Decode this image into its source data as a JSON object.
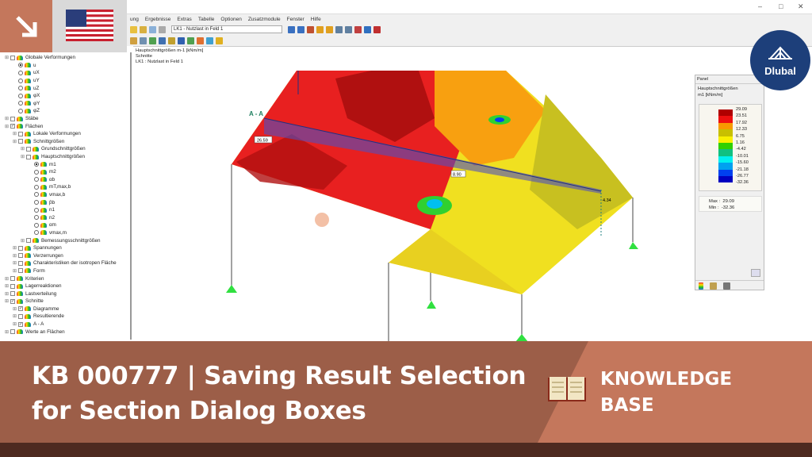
{
  "menu": [
    "ung",
    "Ergebnisse",
    "Extras",
    "Tabelle",
    "Optionen",
    "Zusatzmodule",
    "Fenster",
    "Hilfe"
  ],
  "toolbar": {
    "loadcase": "LK1 - Nutzlast in Feld 1"
  },
  "tree": [
    {
      "l": 0,
      "k": "box",
      "t": "Globale Verformungen"
    },
    {
      "l": 1,
      "k": "rad",
      "on": true,
      "t": "u"
    },
    {
      "l": 1,
      "k": "rad",
      "t": "uX"
    },
    {
      "l": 1,
      "k": "rad",
      "t": "uY"
    },
    {
      "l": 1,
      "k": "rad",
      "t": "uZ"
    },
    {
      "l": 1,
      "k": "rad",
      "t": "φX"
    },
    {
      "l": 1,
      "k": "rad",
      "t": "φY"
    },
    {
      "l": 1,
      "k": "rad",
      "t": "φZ"
    },
    {
      "l": 0,
      "k": "box",
      "t": "Stäbe"
    },
    {
      "l": 0,
      "k": "chk",
      "t": "Flächen"
    },
    {
      "l": 1,
      "k": "box",
      "t": "Lokale Verformungen"
    },
    {
      "l": 1,
      "k": "box",
      "t": "Schnittgrößen"
    },
    {
      "l": 2,
      "k": "box",
      "t": "Grundschnittgrößen"
    },
    {
      "l": 2,
      "k": "box",
      "t": "Hauptschnittgrößen"
    },
    {
      "l": 3,
      "k": "rad",
      "on": true,
      "t": "m1"
    },
    {
      "l": 3,
      "k": "rad",
      "t": "m2"
    },
    {
      "l": 3,
      "k": "rad",
      "t": "αb"
    },
    {
      "l": 3,
      "k": "rad",
      "t": "mT,max,b"
    },
    {
      "l": 3,
      "k": "rad",
      "t": "vmax,b"
    },
    {
      "l": 3,
      "k": "rad",
      "t": "βb"
    },
    {
      "l": 3,
      "k": "rad",
      "t": "n1"
    },
    {
      "l": 3,
      "k": "rad",
      "t": "n2"
    },
    {
      "l": 3,
      "k": "rad",
      "t": "αm"
    },
    {
      "l": 3,
      "k": "rad",
      "t": "vmax,m"
    },
    {
      "l": 2,
      "k": "box",
      "t": "Bemessungsschnittgrößen"
    },
    {
      "l": 1,
      "k": "box",
      "t": "Spannungen"
    },
    {
      "l": 1,
      "k": "box",
      "t": "Verzerrungen"
    },
    {
      "l": 1,
      "k": "box",
      "t": "Charakteristiken der isotropen Fläche"
    },
    {
      "l": 1,
      "k": "box",
      "t": "Form"
    },
    {
      "l": 0,
      "k": "box",
      "t": "Kriterien"
    },
    {
      "l": 0,
      "k": "box",
      "t": "Lagerreaktionen"
    },
    {
      "l": 0,
      "k": "box",
      "t": "Lastverteilung"
    },
    {
      "l": 0,
      "k": "chk",
      "t": "Schnitte"
    },
    {
      "l": 1,
      "k": "chk",
      "t": "Diagramme"
    },
    {
      "l": 1,
      "k": "box",
      "t": "Resultierende"
    },
    {
      "l": 1,
      "k": "chk",
      "t": "A - A"
    },
    {
      "l": 0,
      "k": "box",
      "t": "Werte an Flächen"
    }
  ],
  "view": {
    "info": [
      "Hauptschnittgrößen m-1 [kNm/m]",
      "Schnitte",
      "LK1 : Nutzlast in Feld 1"
    ],
    "section_label": "A - A",
    "values": {
      "v1": "26.59",
      "v2": "8.90",
      "v3": "4.34"
    }
  },
  "panel": {
    "title": "Panel",
    "heading": "Hauptschnittgrößen",
    "unit": "m1 [kNm/m]",
    "legend_values": [
      "29.09",
      "23.51",
      "17.92",
      "12.33",
      "6.75",
      "1.16",
      "-4.42",
      "-10.01",
      "-15.60",
      "-21.18",
      "-26.77",
      "-32.36"
    ],
    "legend_colors": [
      "#b00000",
      "#ee1010",
      "#f89a00",
      "#c8c000",
      "#f8f000",
      "#30d000",
      "#10c080",
      "#00f0f0",
      "#00a0f0",
      "#0040f0",
      "#0000c0"
    ],
    "max_label": "Max :",
    "max": "29.09",
    "min_label": "Min :",
    "min": "-32.36"
  },
  "brand": {
    "name": "Dlubal"
  },
  "banner": {
    "title_line1": "KB 000777 | Saving Result Selection",
    "title_line2": "for Section Dialog Boxes",
    "kb_line1": "KNOWLEDGE",
    "kb_line2": "BASE"
  }
}
